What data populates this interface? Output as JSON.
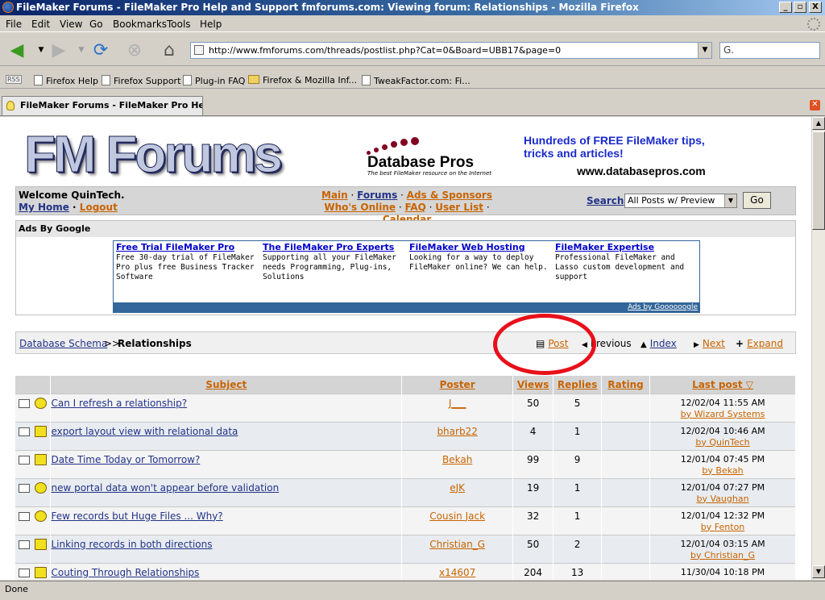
{
  "window": {
    "title": "FileMaker Forums - FileMaker Pro Help and Support fmforums.com: Viewing forum: Relationships - Mozilla Firefox",
    "buttons": [
      "_",
      "▫",
      "X"
    ]
  },
  "menu": [
    "File",
    "Edit",
    "View",
    "Go",
    "Bookmarks",
    "Tools",
    "Help"
  ],
  "address": {
    "url": "http://www.fmforums.com/threads/postlist.php?Cat=0&Board=UBB17&page=0",
    "search_value": "G."
  },
  "rss": "RSS",
  "bookmarks": [
    "Firefox Help",
    "Firefox Support",
    "Plug-in FAQ",
    "Firefox & Mozilla Inf...",
    "TweakFactor.com: Fi..."
  ],
  "tab": {
    "title": "FileMaker Forums - FileMaker Pro He..."
  },
  "header": {
    "logo": "FM Forums",
    "dbp_title": "Database Pros",
    "dbp_tag": "The best FileMaker resource on the Internet",
    "promo": "Hundreds of FREE FileMaker tips, tricks and articles!",
    "promo_url": "www.databasepros.com"
  },
  "nav": {
    "welcome": "Welcome QuinTech.",
    "my_home": "My Home",
    "logout": "Logout",
    "links_row1": [
      "Main",
      "Forums",
      "Ads & Sponsors"
    ],
    "links_row2": [
      "Who's Online",
      "FAQ",
      "User List",
      "Calendar"
    ],
    "search_label": "Search",
    "search_option": "All Posts w/ Preview",
    "go": "Go"
  },
  "ads": {
    "heading": "Ads By Google",
    "items": [
      {
        "title": "Free Trial FileMaker Pro",
        "text": "Free 30-day trial of FileMaker Pro plus free Business Tracker Software"
      },
      {
        "title": "The FileMaker Pro Experts",
        "text": "Supporting all your FileMaker needs Programming, Plug-ins, Solutions"
      },
      {
        "title": "FileMaker Web Hosting",
        "text": "Looking for a way to deploy FileMaker online? We can help."
      },
      {
        "title": "FileMaker Expertise",
        "text": "Professional FileMaker and Lasso custom development and support"
      }
    ],
    "footer": "Ads by Goooooogle"
  },
  "breadcrumb": {
    "parent": "Database Schema",
    "sep": ">>",
    "current": "Relationships"
  },
  "actions": {
    "post": "Post",
    "previous": "Previous",
    "index": "Index",
    "next": "Next",
    "expand": "Expand"
  },
  "table": {
    "headers": {
      "subject": "Subject",
      "poster": "Poster",
      "views": "Views",
      "replies": "Replies",
      "rating": "Rating",
      "last": "Last post ▽"
    },
    "rows": [
      {
        "subject": "Can I refresh a relationship?",
        "poster": "J___",
        "views": "50",
        "replies": "5",
        "date": "12/02/04 11:55 AM",
        "by": "by Wizard Systems",
        "icon": "smiley-icon"
      },
      {
        "subject": "export layout view with relational data",
        "poster": "bharb22",
        "views": "4",
        "replies": "1",
        "date": "12/02/04 10:46 AM",
        "by": "by QuinTech",
        "icon": "book-icon"
      },
      {
        "subject": "Date Time Today or Tomorrow?",
        "poster": "Bekah",
        "views": "99",
        "replies": "9",
        "date": "12/01/04 07:45 PM",
        "by": "by Bekah",
        "icon": "book-icon"
      },
      {
        "subject": "new portal data won't appear before validation",
        "poster": "eJK",
        "views": "19",
        "replies": "1",
        "date": "12/01/04 07:27 PM",
        "by": "by Vaughan",
        "icon": "smiley-icon"
      },
      {
        "subject": "Few records but Huge Files ... Why?",
        "poster": "Cousin Jack",
        "views": "32",
        "replies": "1",
        "date": "12/01/04 12:32 PM",
        "by": "by Fenton",
        "icon": "smiley-icon"
      },
      {
        "subject": "Linking records in both directions",
        "poster": "Christian_G",
        "views": "50",
        "replies": "2",
        "date": "12/01/04 03:15 AM",
        "by": "by Christian_G",
        "icon": "book-icon"
      },
      {
        "subject": "Couting Through Relationships",
        "poster": "x14607",
        "views": "204",
        "replies": "13",
        "date": "11/30/04 10:18 PM",
        "by": "",
        "icon": "book-icon"
      }
    ]
  },
  "status": "Done"
}
